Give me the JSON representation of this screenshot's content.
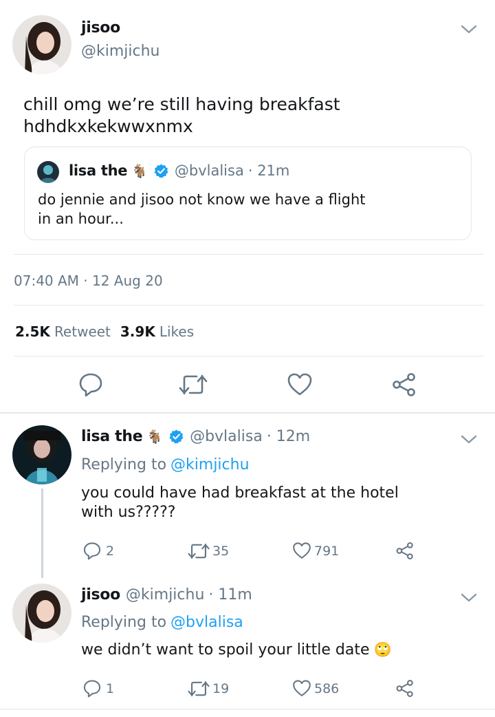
{
  "main_tweet": {
    "name": "jisoo",
    "handle": "@kimjichu",
    "text_line1": "chill omg we’re still having breakfast",
    "text_line2": "hdhdkxkekwwxnmx",
    "quote": {
      "name": "lisa the",
      "emoji": "🐐",
      "handle": "@bvlalisa",
      "time": "· 21m",
      "text_line1": "do jennie and jisoo not know we have a flight",
      "text_line2": "in an hour..."
    },
    "timestamp": "07:40 AM · 12 Aug 20",
    "retweets_count": "2.5K",
    "retweets_label": "Retweet",
    "likes_count": "3.9K",
    "likes_label": "Likes"
  },
  "replies": [
    {
      "name": "lisa the",
      "emoji": "🐐",
      "handle": "@bvlalisa",
      "time": "· 12m",
      "replying_label": "Replying to",
      "replying_to": "@kimjichu",
      "text_line1": "you could have had breakfast at the hotel",
      "text_line2": "with us?????",
      "reply_count": "2",
      "retweet_count": "35",
      "like_count": "791"
    },
    {
      "name": "jisoo",
      "handle": "@kimjichu",
      "time": "· 11m",
      "replying_label": "Replying to",
      "replying_to": "@bvlalisa",
      "text_line1": "we didn’t want to spoil your little date",
      "text_emoji": "🙄",
      "reply_count": "1",
      "retweet_count": "19",
      "like_count": "586"
    }
  ],
  "colors": {
    "accent": "#1da1f2",
    "muted": "#657786",
    "border": "#e1e8ed",
    "text": "#14171a"
  },
  "icons": [
    "chevron-down-icon",
    "verified-icon",
    "reply-icon",
    "retweet-icon",
    "like-icon",
    "share-icon"
  ]
}
